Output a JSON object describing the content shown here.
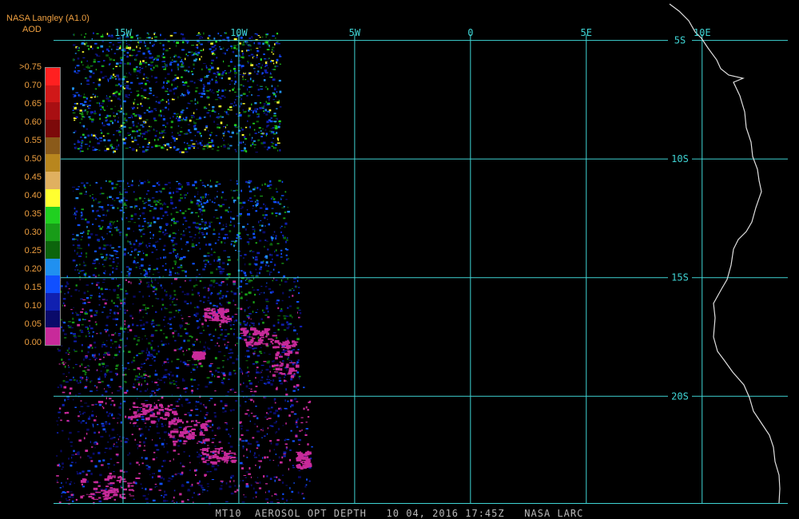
{
  "header": {
    "producer": "NASA Langley (A1.0)",
    "variable": "AOD"
  },
  "legend": {
    "labels": [
      ">0.75",
      "0.70",
      "0.65",
      "0.60",
      "0.55",
      "0.50",
      "0.45",
      "0.40",
      "0.35",
      "0.30",
      "0.25",
      "0.20",
      "0.15",
      "0.10",
      "0.05",
      "0.00"
    ],
    "colors": [
      "#ff2020",
      "#d01818",
      "#a80f12",
      "#7c0a0a",
      "#8a5a1a",
      "#b8861e",
      "#e0b060",
      "#ffff30",
      "#20d020",
      "#189c18",
      "#0c640c",
      "#2090f0",
      "#1050ff",
      "#1020b0",
      "#0a0a6a",
      "#c82a9a"
    ]
  },
  "map": {
    "bounds": {
      "lon_min": -18,
      "lon_max": 13.7,
      "lat_top": -3.5,
      "lat_bottom": -24.5
    },
    "lon_labels": [
      {
        "lon": -15,
        "text": "15W"
      },
      {
        "lon": -10,
        "text": "10W"
      },
      {
        "lon": -5,
        "text": "5W"
      },
      {
        "lon": 0,
        "text": "0"
      },
      {
        "lon": 5,
        "text": "5E"
      },
      {
        "lon": 10,
        "text": "10E"
      }
    ],
    "lat_labels": [
      {
        "lat": -5,
        "text": "5S"
      },
      {
        "lat": -10,
        "text": "10S"
      },
      {
        "lat": -15,
        "text": "15S"
      },
      {
        "lat": -20,
        "text": "20S"
      }
    ],
    "grid_color": "#3fd4d4",
    "coast_color": "#e0e0e0"
  },
  "footer": {
    "product": "MT10",
    "parameter": "AEROSOL OPT DEPTH",
    "datetime": "10 04, 2016 17:45Z",
    "source": "NASA LARC"
  }
}
